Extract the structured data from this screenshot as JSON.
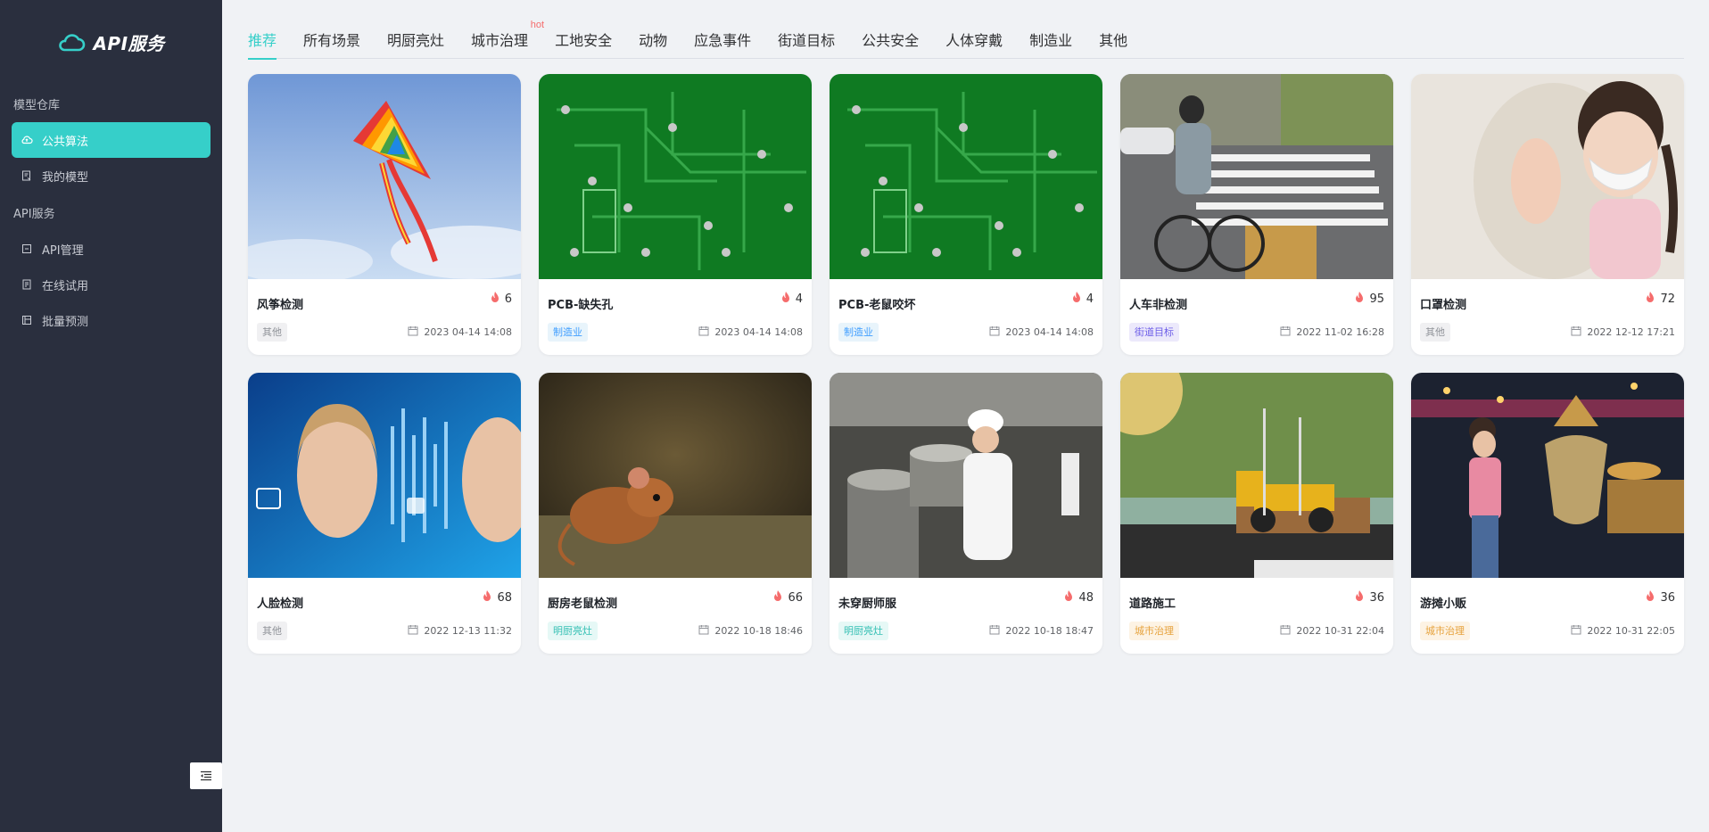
{
  "app": {
    "title": "API服务",
    "accent": "#36cfc9"
  },
  "sidebar": {
    "sections": [
      {
        "label": "模型仓库",
        "items": [
          {
            "label": "公共算法",
            "icon": "cloud-upload-icon",
            "active": true
          },
          {
            "label": "我的模型",
            "icon": "model-doc-icon",
            "active": false
          }
        ]
      },
      {
        "label": "API服务",
        "items": [
          {
            "label": "API管理",
            "icon": "api-manage-icon",
            "active": false
          },
          {
            "label": "在线试用",
            "icon": "trial-doc-icon",
            "active": false
          },
          {
            "label": "批量预测",
            "icon": "batch-predict-icon",
            "active": false
          }
        ]
      }
    ],
    "collapse_icon": "menu-fold-icon"
  },
  "tabs": {
    "items": [
      "推荐",
      "所有场景",
      "明厨亮灶",
      "城市治理",
      "工地安全",
      "动物",
      "应急事件",
      "街道目标",
      "公共安全",
      "人体穿戴",
      "制造业",
      "其他"
    ],
    "active": "推荐",
    "hot_label": "hot",
    "hot_on": "城市治理"
  },
  "cards": [
    {
      "title": "风筝检测",
      "heat": "6",
      "tag": "其他",
      "tag_style": "gray",
      "date": "2023 04-14 14:08",
      "image": "kite"
    },
    {
      "title": "PCB-缺失孔",
      "heat": "4",
      "tag": "制造业",
      "tag_style": "blue",
      "date": "2023 04-14 14:08",
      "image": "pcb"
    },
    {
      "title": "PCB-老鼠咬坏",
      "heat": "4",
      "tag": "制造业",
      "tag_style": "blue",
      "date": "2023 04-14 14:08",
      "image": "pcb"
    },
    {
      "title": "人车非检测",
      "heat": "95",
      "tag": "街道目标",
      "tag_style": "purple",
      "date": "2022 11-02 16:28",
      "image": "street"
    },
    {
      "title": "口罩检测",
      "heat": "72",
      "tag": "其他",
      "tag_style": "gray",
      "date": "2022 12-12 17:21",
      "image": "mask"
    },
    {
      "title": "人脸检测",
      "heat": "68",
      "tag": "其他",
      "tag_style": "gray",
      "date": "2022 12-13 11:32",
      "image": "face"
    },
    {
      "title": "厨房老鼠检测",
      "heat": "66",
      "tag": "明厨亮灶",
      "tag_style": "teal",
      "date": "2022 10-18 18:46",
      "image": "mouse"
    },
    {
      "title": "未穿厨师服",
      "heat": "48",
      "tag": "明厨亮灶",
      "tag_style": "teal",
      "date": "2022 10-18 18:47",
      "image": "chef"
    },
    {
      "title": "道路施工",
      "heat": "36",
      "tag": "城市治理",
      "tag_style": "orange",
      "date": "2022 10-31 22:04",
      "image": "construction"
    },
    {
      "title": "游摊小贩",
      "heat": "36",
      "tag": "城市治理",
      "tag_style": "orange",
      "date": "2022 10-31 22:05",
      "image": "vendor"
    }
  ],
  "icons": {
    "heat": "flame-icon",
    "date": "calendar-icon",
    "brand": "cloud-logo-icon"
  }
}
